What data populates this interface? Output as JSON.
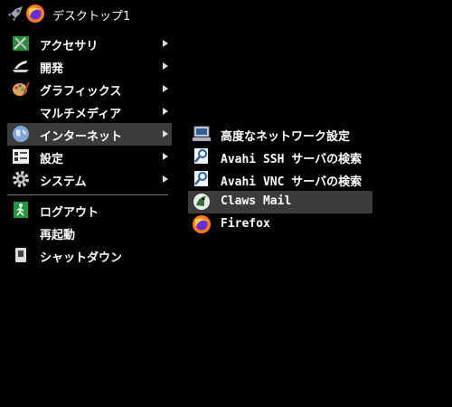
{
  "taskbar": {
    "title": "デスクトップ1",
    "icons": [
      "rocket-launcher-icon",
      "firefox-icon"
    ]
  },
  "main_menu": {
    "items": [
      {
        "label": "アクセサリ",
        "icon": "accessories-icon",
        "submenu": true
      },
      {
        "label": "開発",
        "icon": "development-icon",
        "submenu": true
      },
      {
        "label": "グラフィックス",
        "icon": "graphics-icon",
        "submenu": true
      },
      {
        "label": "マルチメディア",
        "icon": "",
        "submenu": true
      },
      {
        "label": "インターネット",
        "icon": "internet-globe-icon",
        "submenu": true,
        "active": true
      },
      {
        "label": "設定",
        "icon": "settings-icon",
        "submenu": true
      },
      {
        "label": "システム",
        "icon": "system-gear-icon",
        "submenu": true
      }
    ],
    "bottom_items": [
      {
        "label": "ログアウト",
        "icon": "logout-icon"
      },
      {
        "label": "再起動",
        "icon": ""
      },
      {
        "label": "シャットダウン",
        "icon": "shutdown-icon"
      }
    ]
  },
  "internet_submenu": {
    "items": [
      {
        "label": "高度なネットワーク設定",
        "icon": "network-settings-icon"
      },
      {
        "label": "Avahi SSH サーバの検索",
        "icon": "avahi-ssh-icon"
      },
      {
        "label": "Avahi VNC サーバの検索",
        "icon": "avahi-vnc-icon"
      },
      {
        "label": "Claws Mail",
        "icon": "claws-mail-icon",
        "active": true
      },
      {
        "label": "Firefox",
        "icon": "firefox-icon"
      }
    ]
  },
  "colors": {
    "background": "#000000",
    "highlight": "#3b3b3b",
    "separator": "#777777",
    "text": "#ffffff"
  }
}
